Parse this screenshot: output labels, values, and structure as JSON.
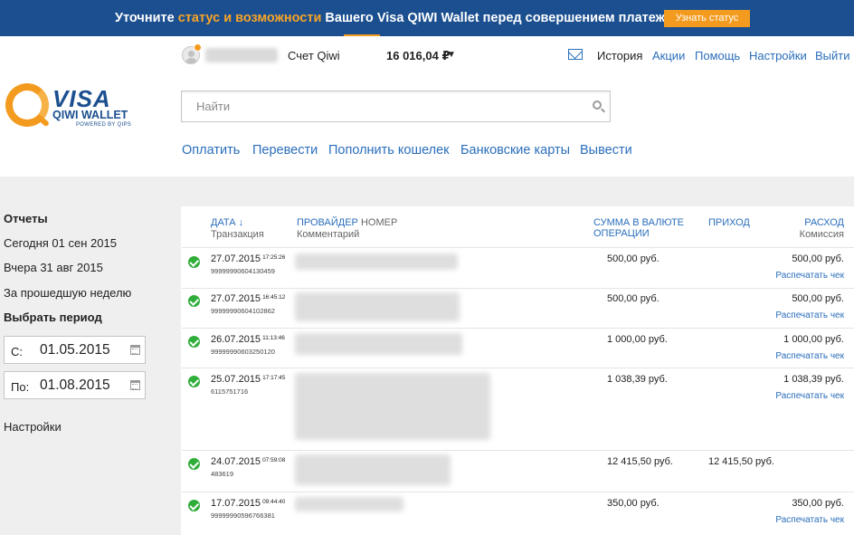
{
  "banner": {
    "text_before": "Уточните ",
    "accent": "статус и возможности",
    "text_after": " Вашего Visa QIWI Wallet перед совершением платежа.",
    "button": "Узнать статус"
  },
  "account": {
    "label": "Счет Qiwi",
    "balance": "16 016,04 ₽"
  },
  "topnav": [
    "История",
    "Акции",
    "Помощь",
    "Настройки",
    "Выйти"
  ],
  "logo": {
    "visa": "VISA",
    "wallet": "QIWI WALLET",
    "powered": "POWERED BY QIPS"
  },
  "search": {
    "placeholder": "Найти"
  },
  "mainnav": [
    "Оплатить",
    "Перевести",
    "Пополнить кошелек",
    "Банковские карты",
    "Вывести"
  ],
  "sidebar": {
    "reports": "Отчеты",
    "today": "Сегодня 01 сен 2015",
    "yesterday": "Вчера 31 авг 2015",
    "last_week": "За прошедшую неделю",
    "choose_period": "Выбрать период",
    "from_label": "С:",
    "from_value": "01.05.2015",
    "to_label": "По:",
    "to_value": "01.08.2015",
    "settings": "Настройки"
  },
  "table": {
    "headers": {
      "date": "ДАТА ↓",
      "date_sub": "Транзакция",
      "provider": "ПРОВАЙДЕР",
      "number": " НОМЕР",
      "provider_sub": "Комментарий",
      "amount": "СУММА В ВАЛЮТЕ",
      "amount2": "ОПЕРАЦИИ",
      "income": "ПРИХОД",
      "expense": "РАСХОД",
      "expense_sub": "Комиссия"
    },
    "print_label": "Распечатать чек",
    "rows": [
      {
        "date": "27.07.2015",
        "time": "17:25:26",
        "id": "99999990604130459",
        "amount": "500,00 руб.",
        "income": "",
        "expense": "500,00 руб."
      },
      {
        "date": "27.07.2015",
        "time": "16:45:12",
        "id": "99999990604102862",
        "amount": "500,00 руб.",
        "income": "",
        "expense": "500,00 руб."
      },
      {
        "date": "26.07.2015",
        "time": "11:13:46",
        "id": "99999990603250120",
        "amount": "1 000,00 руб.",
        "income": "",
        "expense": "1 000,00 руб."
      },
      {
        "date": "25.07.2015",
        "time": "17:17:45",
        "id": "6115751716",
        "amount": "1 038,39 руб.",
        "income": "",
        "expense": "1 038,39 руб."
      },
      {
        "date": "24.07.2015",
        "time": "07:59:08",
        "id": "483619",
        "amount": "12 415,50 руб.",
        "income": "12 415,50 руб.",
        "expense": ""
      },
      {
        "date": "17.07.2015",
        "time": "09:44:40",
        "id": "99999990596766381",
        "amount": "350,00 руб.",
        "income": "",
        "expense": "350,00 руб."
      }
    ]
  }
}
